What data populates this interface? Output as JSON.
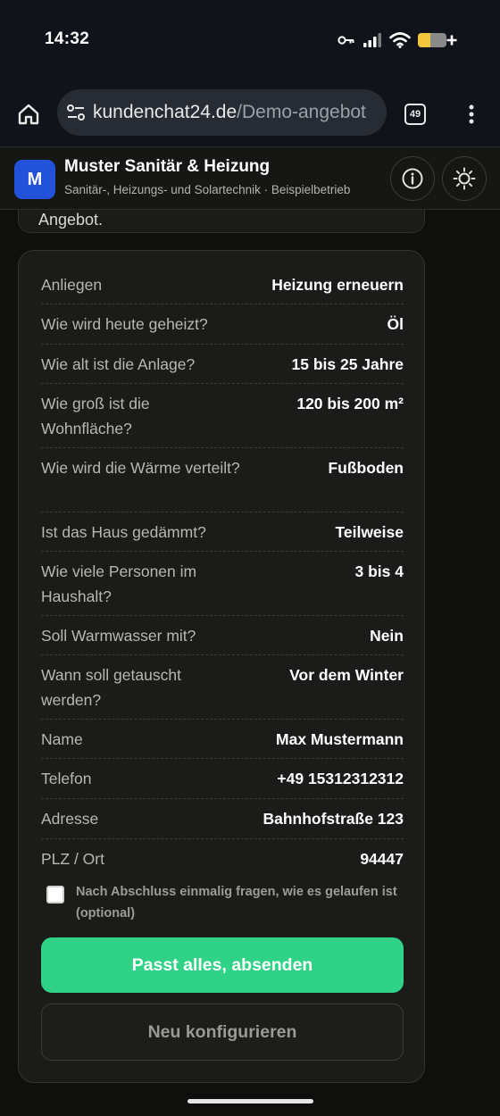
{
  "status_bar": {
    "time": "14:32"
  },
  "browser": {
    "url_domain": "kundenchat24.de",
    "url_path": "/Demo-angebot",
    "tab_count": "49"
  },
  "header": {
    "logo_letter": "M",
    "title": "Muster Sanitär & Heizung",
    "subtitle": "Sanitär-, Heizungs- und Solartechnik · Beispielbetrieb"
  },
  "previous_card": {
    "text": "Angebot."
  },
  "summary": {
    "rows": [
      {
        "label": "Anliegen",
        "value": "Heizung erneuern"
      },
      {
        "label": "Wie wird heute geheizt?",
        "value": "Öl"
      },
      {
        "label": "Wie alt ist die Anlage?",
        "value": "15 bis 25 Jahre"
      },
      {
        "label": "Wie groß ist die Wohnfläche?",
        "value": "120 bis 200 m²"
      },
      {
        "label": "Wie wird die Wärme verteilt?",
        "value": "Fußboden"
      },
      {
        "label": "Ist das Haus gedämmt?",
        "value": "Teilweise"
      },
      {
        "label": "Wie viele Personen im Haushalt?",
        "value": "3 bis 4"
      },
      {
        "label": "Soll Warmwasser mit?",
        "value": "Nein"
      },
      {
        "label": "Wann soll getauscht werden?",
        "value": "Vor dem Winter"
      },
      {
        "label": "Name",
        "value": "Max Mustermann"
      },
      {
        "label": "Telefon",
        "value": "+49 15312312312"
      },
      {
        "label": "Adresse",
        "value": "Bahnhofstraße 123"
      },
      {
        "label": "PLZ / Ort",
        "value": "94447"
      }
    ],
    "feedback_label": "Nach Abschluss einmalig fragen, wie es gelaufen ist (optional)",
    "feedback_checked": false,
    "submit_label": "Passt alles, absenden",
    "reconfigure_label": "Neu konfigurieren"
  },
  "colors": {
    "accent_green": "#2fd286",
    "logo_blue": "#2252d9",
    "background": "#0f0f0e",
    "card": "#1b1b19"
  },
  "icons": {
    "home": "home-icon",
    "site_settings": "tune-icon",
    "menu": "more-vert-icon",
    "info": "info-icon",
    "theme": "sun-icon"
  }
}
